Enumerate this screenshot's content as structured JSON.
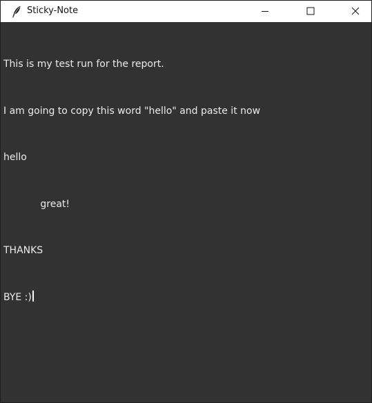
{
  "window": {
    "title": "Sticky-Note",
    "icon": "feather-icon",
    "controls": {
      "minimize_icon": "minimize-icon",
      "maximize_icon": "maximize-icon",
      "close_icon": "close-icon"
    }
  },
  "note": {
    "lines": [
      "This is my test run for the report.",
      "I am going to copy this word \"hello\" and paste it now",
      "hello",
      "            great!",
      "THANKS",
      "BYE :)"
    ],
    "background": "#323232",
    "text_color": "#ececec"
  }
}
